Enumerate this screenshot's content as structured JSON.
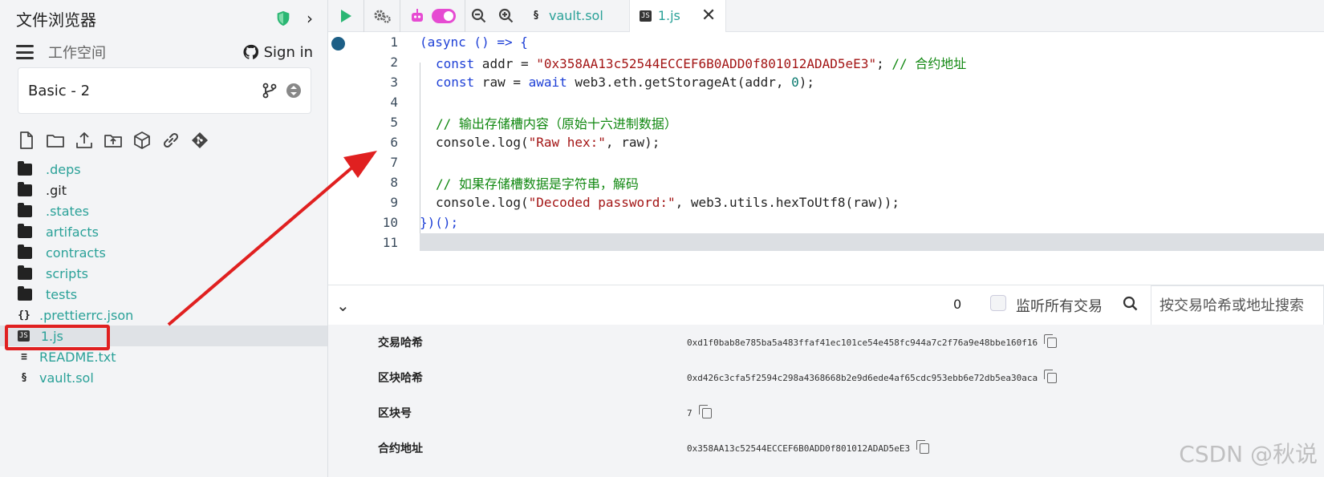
{
  "sidebar": {
    "title": "文件浏览器",
    "workspace_label": "工作空间",
    "sign_in": "Sign in",
    "workspace_value": "Basic - 2",
    "tree": [
      {
        "name": ".deps",
        "type": "folder"
      },
      {
        "name": ".git",
        "type": "folder"
      },
      {
        "name": ".states",
        "type": "folder"
      },
      {
        "name": "artifacts",
        "type": "folder"
      },
      {
        "name": "contracts",
        "type": "folder"
      },
      {
        "name": "scripts",
        "type": "folder"
      },
      {
        "name": "tests",
        "type": "folder"
      },
      {
        "name": ".prettierrc.json",
        "type": "json"
      },
      {
        "name": "1.js",
        "type": "js",
        "selected": true
      },
      {
        "name": "README.txt",
        "type": "txt"
      },
      {
        "name": "vault.sol",
        "type": "sol"
      }
    ]
  },
  "tabs": [
    {
      "label": "vault.sol",
      "icon": "solidity-icon"
    },
    {
      "label": "1.js",
      "icon": "js-icon",
      "active": true
    }
  ],
  "editor": {
    "line_numbers": [
      "1",
      "2",
      "3",
      "4",
      "5",
      "6",
      "7",
      "8",
      "9",
      "10",
      "11"
    ],
    "lines": {
      "l1_a": "(async () => {",
      "l2_kw": "const",
      "l2_plain": " addr = ",
      "l2_str": "\"0x358AA13c52544ECCEF6B0ADD0f801012ADAD5eE3\"",
      "l2_semi": "; ",
      "l2_cm": "// 合约地址",
      "l3_kw": "const",
      "l3_plain1": " raw = ",
      "l3_kw2": "await",
      "l3_plain2": " web3.eth.getStorageAt(addr, ",
      "l3_num": "0",
      "l3_end": ");",
      "l5_cm": "// 输出存储槽内容（原始十六进制数据）",
      "l6_plain1": "console.log(",
      "l6_str": "\"Raw hex:\"",
      "l6_plain2": ", raw);",
      "l8_cm": "// 如果存储槽数据是字符串，解码",
      "l9_plain1": "console.log(",
      "l9_str": "\"Decoded password:\"",
      "l9_plain2": ", web3.utils.hexToUtf8(raw));",
      "l10": "})();"
    }
  },
  "panel": {
    "pending_count": "0",
    "listen_label": "监听所有交易",
    "search_placeholder": "按交易哈希或地址搜索",
    "details": [
      {
        "label": "交易哈希",
        "value": "0xd1f0bab8e785ba5a483ffaf41ec101ce54e458fc944a7c2f76a9e48bbe160f16"
      },
      {
        "label": "区块哈希",
        "value": "0xd426c3cfa5f2594c298a4368668b2e9d6ede4af65cdc953ebb6e72db5ea30aca"
      },
      {
        "label": "区块号",
        "value": "7"
      },
      {
        "label": "合约地址",
        "value": "0x358AA13c52544ECCEF6B0ADD0f801012ADAD5eE3"
      }
    ]
  },
  "watermark": "CSDN @秋说",
  "colors": {
    "accent": "#2aa198",
    "toggle": "#e64bd2",
    "annotation": "#e02020"
  }
}
